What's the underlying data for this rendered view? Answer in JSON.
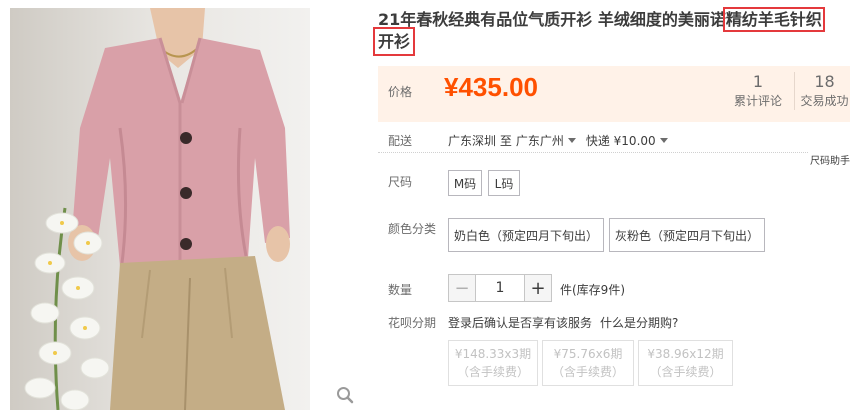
{
  "product": {
    "title_part1": "21年春秋经典有品位气质开衫 羊绒细度的美丽诺",
    "title_highlight1": "精纺羊毛针织",
    "title_highlight2": "开衫"
  },
  "price": {
    "label": "价格",
    "value": "¥435.00",
    "reviews_count": "1",
    "reviews_label": "累计评论",
    "sales_count": "18",
    "sales_label": "交易成功"
  },
  "shipping": {
    "label": "配送",
    "from": "广东深圳 至",
    "to": "广东广州",
    "method": "快递 ¥10.00"
  },
  "size_help": "尺码助手",
  "size": {
    "label": "尺码",
    "options": [
      "M码",
      "L码"
    ]
  },
  "color": {
    "label": "颜色分类",
    "options": [
      "奶白色（预定四月下旬出）",
      "灰粉色（预定四月下旬出）"
    ]
  },
  "quantity": {
    "label": "数量",
    "value": "1",
    "minus": "−",
    "plus": "+",
    "stock": "件(库存9件)"
  },
  "huabei": {
    "label": "花呗分期",
    "login_text": "登录后确认是否享有该服务",
    "what_link": "什么是分期购?",
    "installments": [
      {
        "amount": "¥148.33x3期",
        "fee": "（含手续费）"
      },
      {
        "amount": "¥75.76x6期",
        "fee": "（含手续费）"
      },
      {
        "amount": "¥38.96x12期",
        "fee": "（含手续费）"
      }
    ]
  },
  "colors": {
    "accent": "#ff5000",
    "highlight_border": "#e4393c",
    "price_bg": "#fff2e8",
    "cardigan": "#d9a0a8",
    "pants": "#c4ad86"
  }
}
